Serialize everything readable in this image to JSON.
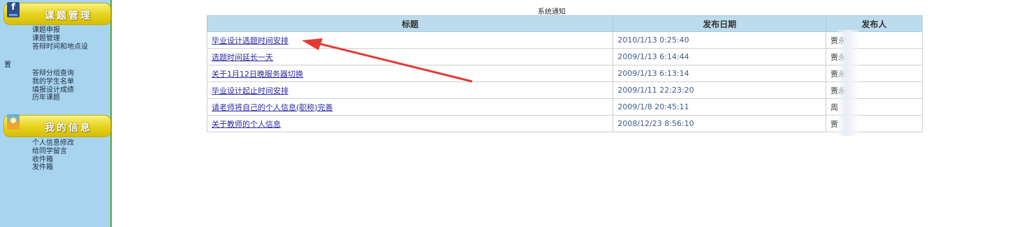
{
  "sidebar": {
    "sections": [
      {
        "title": "课题管理",
        "items": [
          "课题申报",
          "课题管理",
          "答辩时间和地点设置",
          "答辩分组查询",
          "我的学生名单",
          "填报设计成绩",
          "历年课题"
        ]
      },
      {
        "title": "我的信息",
        "items": [
          "个人信息修改",
          "给同学留言",
          "收件箱",
          "发件箱"
        ]
      }
    ]
  },
  "main": {
    "caption": "系统通知",
    "columns": [
      "标题",
      "发布日期",
      "发布人"
    ],
    "rows": [
      {
        "title": "毕业设计选题时间安排",
        "date": "2010/1/13 0:25:40",
        "publisher": "贾永"
      },
      {
        "title": "选题时间延长一天",
        "date": "2009/1/13 6:14:44",
        "publisher": "贾永"
      },
      {
        "title": "关于1月12日晚服务器切换",
        "date": "2009/1/13 6:13:14",
        "publisher": "贾永"
      },
      {
        "title": "毕业设计起止时间安排",
        "date": "2009/1/11 22:23:20",
        "publisher": "贾永"
      },
      {
        "title": "请老师将自己的个人信息(职称)完善",
        "date": "2009/1/8 20:45:11",
        "publisher": "周"
      },
      {
        "title": "关于教师的个人信息",
        "date": "2008/12/23 8:56:10",
        "publisher": "贾"
      }
    ]
  },
  "annotation_color": "#e53935"
}
